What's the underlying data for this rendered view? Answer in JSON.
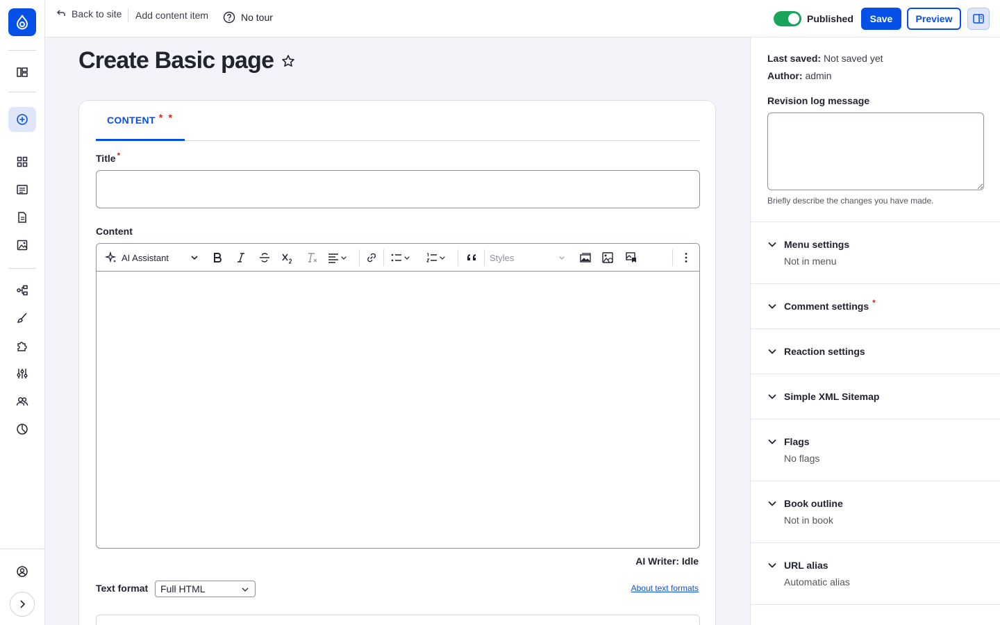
{
  "topbar": {
    "back_label": "Back to site",
    "add_content_label": "Add content item",
    "tour_label": "No tour",
    "published_label": "Published",
    "save_label": "Save",
    "preview_label": "Preview"
  },
  "page": {
    "title": "Create Basic page"
  },
  "form": {
    "tab_label": "CONTENT",
    "tab_req_1": "*",
    "tab_req_2": "*",
    "title_label": "Title",
    "required_mark": "*",
    "content_label": "Content",
    "toolbar": {
      "ai_assistant": "AI Assistant",
      "styles_placeholder": "Styles"
    },
    "ai_writer_status": "AI Writer: Idle",
    "text_format_label": "Text format",
    "text_format_value": "Full HTML",
    "about_text_formats": "About text formats"
  },
  "sidebar": {
    "last_saved_label": "Last saved:",
    "last_saved_value": "Not saved yet",
    "author_label": "Author:",
    "author_value": "admin",
    "revision_label": "Revision log message",
    "revision_desc": "Briefly describe the changes you have made.",
    "sections": [
      {
        "title": "Menu settings",
        "summary": "Not in menu"
      },
      {
        "title": "Comment settings",
        "summary": ""
      },
      {
        "title": "Reaction settings",
        "summary": ""
      },
      {
        "title": "Simple XML Sitemap",
        "summary": ""
      },
      {
        "title": "Flags",
        "summary": "No flags"
      },
      {
        "title": "Book outline",
        "summary": "Not in book"
      },
      {
        "title": "URL alias",
        "summary": "Automatic alias"
      }
    ]
  },
  "colors": {
    "brand": "#0550e6",
    "toggle_on": "#1aa35a",
    "required": "#d72222"
  }
}
